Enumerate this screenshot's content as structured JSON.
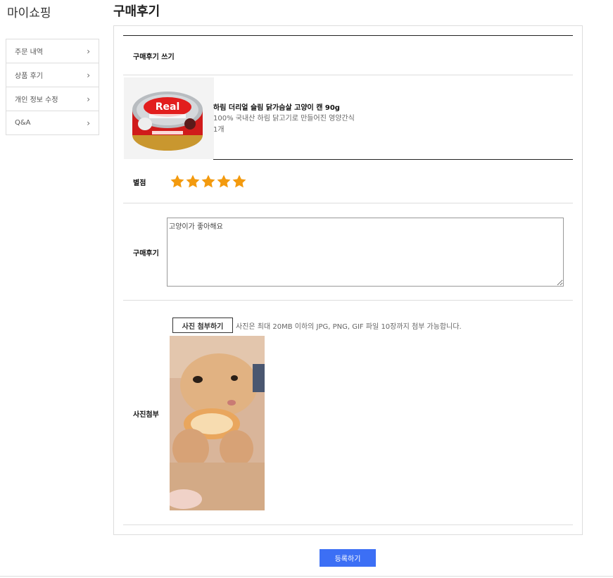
{
  "sidebar": {
    "title": "마이쇼핑",
    "items": [
      {
        "label": "주문 내역"
      },
      {
        "label": "상품 후기"
      },
      {
        "label": "개인 정보 수정"
      },
      {
        "label": "Q&A"
      }
    ]
  },
  "page": {
    "title": "구매후기"
  },
  "form": {
    "section_label": "구매후기 쓰기",
    "product": {
      "name": "하림 더리얼 슬림 닭가슴살 고양이 캔 90g",
      "description": "100% 국내산 하림 닭고기로 만들어진 영양간식",
      "quantity": "1개",
      "image_icon": "cat-food-can"
    },
    "rating": {
      "label": "별점",
      "value": 5,
      "max": 5,
      "color": "#f39a0e"
    },
    "review": {
      "label": "구매후기",
      "value": "고양이가 좋아해요"
    },
    "photo": {
      "label": "사진첨부",
      "attach_button": "사진 첨부하기",
      "note": "사진은 최대 20MB 이하의 JPG, PNG, GIF 파일 10장까지 첨부 가능합니다.",
      "image_icon": "cat-eating-bread-photo"
    }
  },
  "submit": {
    "label": "등록하기",
    "color": "#3c6ff5"
  }
}
